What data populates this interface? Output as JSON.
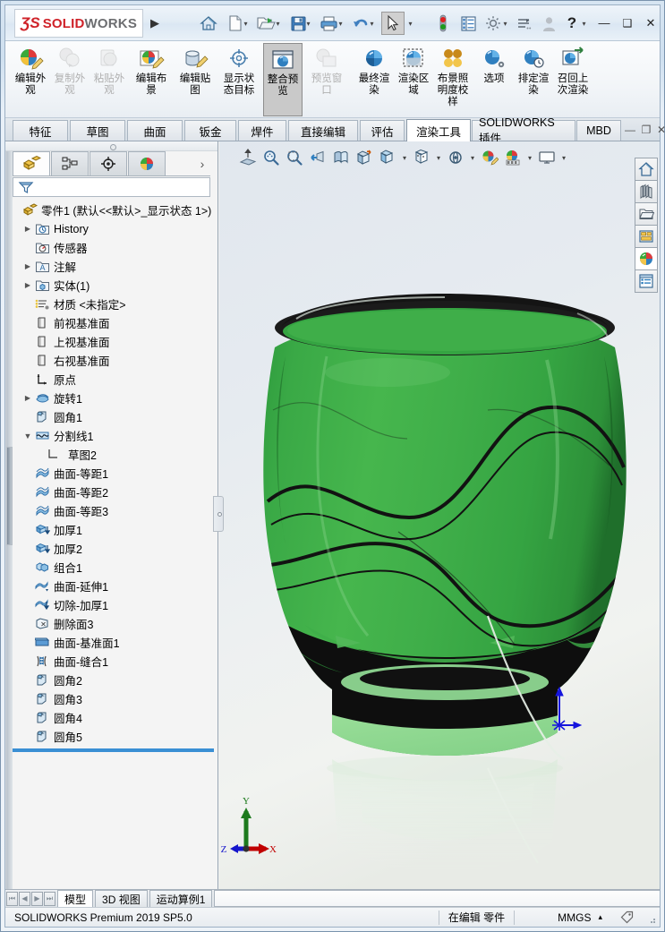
{
  "app": {
    "logo_ds": "ƷS",
    "logo_bold": "SOLID",
    "logo_light": "WORKS",
    "logo_arrow": "▶"
  },
  "titlebar": {
    "icons": [
      {
        "name": "home-icon",
        "label": "home"
      },
      {
        "name": "new-document-icon",
        "label": "new"
      },
      {
        "name": "open-document-icon",
        "label": "open"
      },
      {
        "name": "save-icon",
        "label": "save"
      },
      {
        "name": "print-icon",
        "label": "print"
      },
      {
        "name": "undo-icon",
        "label": "undo"
      },
      {
        "name": "select-cursor-icon",
        "label": "select"
      },
      {
        "name": "rebuild-icon",
        "label": "rebuild"
      },
      {
        "name": "options-list-icon",
        "label": "options-list"
      },
      {
        "name": "settings-gear-icon",
        "label": "settings"
      },
      {
        "name": "customize-icon",
        "label": "customize"
      },
      {
        "name": "user-account-icon",
        "label": "account"
      },
      {
        "name": "help-icon",
        "label": "help"
      }
    ],
    "window_buttons": {
      "minimize": "—",
      "maximize": "❑",
      "close": "✕"
    }
  },
  "ribbon": {
    "buttons": [
      {
        "label": "编辑外观",
        "name": "edit-appearance-button",
        "enabled": true,
        "selected": false,
        "icon": "appearance-edit-icon"
      },
      {
        "label": "复制外观",
        "name": "copy-appearance-button",
        "enabled": false,
        "selected": false,
        "icon": "appearance-copy-icon"
      },
      {
        "label": "粘贴外观",
        "name": "paste-appearance-button",
        "enabled": false,
        "selected": false,
        "icon": "appearance-paste-icon"
      },
      {
        "label": "编辑布景",
        "name": "edit-scene-button",
        "enabled": true,
        "selected": false,
        "icon": "scene-edit-icon"
      },
      {
        "label": "编辑贴图",
        "name": "edit-decal-button",
        "enabled": true,
        "selected": false,
        "icon": "decal-edit-icon"
      },
      {
        "label": "显示状态目标",
        "name": "display-state-target-button",
        "enabled": true,
        "selected": false,
        "icon": "display-state-icon"
      },
      {
        "label": "整合预览",
        "name": "integrated-preview-button",
        "enabled": true,
        "selected": true,
        "icon": "integrated-preview-icon"
      },
      {
        "label": "预览窗口",
        "name": "preview-window-button",
        "enabled": false,
        "selected": false,
        "icon": "preview-window-icon"
      },
      {
        "label": "最终渲染",
        "name": "final-render-button",
        "enabled": true,
        "selected": false,
        "icon": "final-render-icon"
      },
      {
        "label": "渲染区域",
        "name": "render-region-button",
        "enabled": true,
        "selected": false,
        "icon": "render-region-icon"
      },
      {
        "label": "布景照明度校样",
        "name": "scene-illumination-proof-button",
        "enabled": true,
        "selected": false,
        "icon": "illumination-proof-icon"
      },
      {
        "label": "选项",
        "name": "options-button",
        "enabled": true,
        "selected": false,
        "icon": "render-options-icon"
      },
      {
        "label": "排定渲染",
        "name": "schedule-render-button",
        "enabled": true,
        "selected": false,
        "icon": "schedule-render-icon"
      },
      {
        "label": "召回上次渲染",
        "name": "recall-last-render-button",
        "enabled": true,
        "selected": false,
        "icon": "recall-render-icon"
      }
    ]
  },
  "tabs": {
    "items": [
      {
        "label": "特征",
        "name": "tab-features",
        "active": false
      },
      {
        "label": "草图",
        "name": "tab-sketch",
        "active": false
      },
      {
        "label": "曲面",
        "name": "tab-surfaces",
        "active": false
      },
      {
        "label": "钣金",
        "name": "tab-sheetmetal",
        "active": false
      },
      {
        "label": "焊件",
        "name": "tab-weldments",
        "active": false
      },
      {
        "label": "直接编辑",
        "name": "tab-direct-editing",
        "active": false
      },
      {
        "label": "评估",
        "name": "tab-evaluate",
        "active": false
      },
      {
        "label": "渲染工具",
        "name": "tab-render-tools",
        "active": true
      },
      {
        "label": "SOLIDWORKS 插件",
        "name": "tab-solidworks-addins",
        "active": false
      },
      {
        "label": "MBD",
        "name": "tab-mbd",
        "active": false
      }
    ],
    "window_buttons": {
      "minimize": "—",
      "restore": "❐",
      "close": "✕"
    }
  },
  "feature_manager": {
    "tabs": [
      {
        "name": "feature-manager-tree-tab",
        "icon": "feature-tree-icon",
        "active": true
      },
      {
        "name": "property-manager-tab",
        "icon": "property-manager-icon",
        "active": false
      },
      {
        "name": "configuration-manager-tab",
        "icon": "configuration-manager-icon",
        "active": false
      },
      {
        "name": "display-manager-tab",
        "icon": "display-manager-icon",
        "active": false
      }
    ],
    "more_arrow": "›",
    "filter": {
      "name": "tree-filter-input",
      "placeholder": "",
      "value": "",
      "icon": "filter-funnel-icon"
    },
    "tree": [
      {
        "label": "零件1  (默认<<默认>_显示状态 1>)",
        "indent": 0,
        "expander": "",
        "icon": "part-icon",
        "bold": false
      },
      {
        "label": "History",
        "indent": 1,
        "expander": "▶",
        "icon": "history-folder-icon",
        "bold": false
      },
      {
        "label": "传感器",
        "indent": 1,
        "expander": "",
        "icon": "sensor-folder-icon",
        "bold": false
      },
      {
        "label": "注解",
        "indent": 1,
        "expander": "▶",
        "icon": "annotations-folder-icon",
        "bold": false
      },
      {
        "label": "实体(1)",
        "indent": 1,
        "expander": "▶",
        "icon": "solid-bodies-folder-icon",
        "bold": false
      },
      {
        "label": "材质 <未指定>",
        "indent": 1,
        "expander": "",
        "icon": "material-icon",
        "bold": false
      },
      {
        "label": "前视基准面",
        "indent": 1,
        "expander": "",
        "icon": "plane-icon",
        "bold": false
      },
      {
        "label": "上视基准面",
        "indent": 1,
        "expander": "",
        "icon": "plane-icon",
        "bold": false
      },
      {
        "label": "右视基准面",
        "indent": 1,
        "expander": "",
        "icon": "plane-icon",
        "bold": false
      },
      {
        "label": "原点",
        "indent": 1,
        "expander": "",
        "icon": "origin-icon",
        "bold": false
      },
      {
        "label": "旋转1",
        "indent": 1,
        "expander": "▶",
        "icon": "revolve-icon",
        "bold": false
      },
      {
        "label": "圆角1",
        "indent": 1,
        "expander": "",
        "icon": "fillet-icon",
        "bold": false
      },
      {
        "label": "分割线1",
        "indent": 1,
        "expander": "▼",
        "icon": "split-line-icon",
        "bold": false
      },
      {
        "label": "草图2",
        "indent": 2,
        "expander": "",
        "icon": "sketch-icon",
        "bold": false
      },
      {
        "label": "曲面-等距1",
        "indent": 1,
        "expander": "",
        "icon": "offset-surface-icon",
        "bold": false
      },
      {
        "label": "曲面-等距2",
        "indent": 1,
        "expander": "",
        "icon": "offset-surface-icon",
        "bold": false
      },
      {
        "label": "曲面-等距3",
        "indent": 1,
        "expander": "",
        "icon": "offset-surface-icon",
        "bold": false
      },
      {
        "label": "加厚1",
        "indent": 1,
        "expander": "",
        "icon": "thicken-icon",
        "bold": false
      },
      {
        "label": "加厚2",
        "indent": 1,
        "expander": "",
        "icon": "thicken-icon",
        "bold": false
      },
      {
        "label": "组合1",
        "indent": 1,
        "expander": "",
        "icon": "combine-icon",
        "bold": false
      },
      {
        "label": "曲面-延伸1",
        "indent": 1,
        "expander": "",
        "icon": "extend-surface-icon",
        "bold": false
      },
      {
        "label": "切除-加厚1",
        "indent": 1,
        "expander": "",
        "icon": "thicken-cut-icon",
        "bold": false
      },
      {
        "label": "删除面3",
        "indent": 1,
        "expander": "",
        "icon": "delete-face-icon",
        "bold": false
      },
      {
        "label": "曲面-基准面1",
        "indent": 1,
        "expander": "",
        "icon": "planar-surface-icon",
        "bold": false
      },
      {
        "label": "曲面-缝合1",
        "indent": 1,
        "expander": "",
        "icon": "knit-surface-icon",
        "bold": false
      },
      {
        "label": "圆角2",
        "indent": 1,
        "expander": "",
        "icon": "fillet-icon",
        "bold": false
      },
      {
        "label": "圆角3",
        "indent": 1,
        "expander": "",
        "icon": "fillet-icon",
        "bold": false
      },
      {
        "label": "圆角4",
        "indent": 1,
        "expander": "",
        "icon": "fillet-icon",
        "bold": false
      },
      {
        "label": "圆角5",
        "indent": 1,
        "expander": "",
        "icon": "fillet-icon",
        "bold": false
      }
    ],
    "rollback_bar": {
      "name": "rollback-bar",
      "color": "#3a8fd4"
    }
  },
  "view_toolbar": {
    "buttons": [
      {
        "name": "zoom-to-fit-icon",
        "label": "整屏显示全图"
      },
      {
        "name": "zoom-to-area-icon",
        "label": "局部放大"
      },
      {
        "name": "zoom-in-out-icon",
        "label": "放大或缩小"
      },
      {
        "name": "previous-view-icon",
        "label": "上一视图"
      },
      {
        "name": "section-view-icon",
        "label": "剖面视图"
      },
      {
        "name": "view-orientation-icon",
        "label": "视图定向"
      },
      {
        "name": "display-style-icon",
        "label": "显示样式"
      },
      {
        "name": "hide-show-items-icon",
        "label": "隐藏/显示项目"
      },
      {
        "name": "edit-appearance-view-icon",
        "label": "编辑外观"
      },
      {
        "name": "apply-scene-icon",
        "label": "应用布景"
      },
      {
        "name": "view-settings-icon",
        "label": "视图设定"
      }
    ]
  },
  "right_dock": {
    "items": [
      {
        "name": "design-library-home-icon",
        "active": false
      },
      {
        "name": "design-library-icon",
        "active": false
      },
      {
        "name": "file-explorer-icon",
        "active": false
      },
      {
        "name": "view-palette-icon",
        "active": false
      },
      {
        "name": "appearances-scenes-decals-icon",
        "active": true
      },
      {
        "name": "custom-properties-icon",
        "active": false
      }
    ]
  },
  "graphics": {
    "triad": {
      "x_label": "X",
      "y_label": "Y",
      "z_label": "Z",
      "x_color": "#cc0000",
      "y_color": "#008000",
      "z_color": "#0000cc"
    },
    "origin": {
      "name": "origin-marker",
      "color": "#0000cc"
    },
    "model": {
      "name": "glass-vase-model",
      "body_color": "#3fae49",
      "band_color": "#101010",
      "base_color": "#96dc96",
      "background_top": "#e3e8ee",
      "background_bottom": "#eceeea"
    }
  },
  "bottom": {
    "nav_buttons": [
      "⏮",
      "◀",
      "▶",
      "⏭"
    ],
    "sheet_tabs": [
      {
        "label": "模型",
        "name": "sheet-tab-model",
        "active": true
      },
      {
        "label": "3D 视图",
        "name": "sheet-tab-3d-views",
        "active": false
      },
      {
        "label": "运动算例1",
        "name": "sheet-tab-motion-study",
        "active": false
      }
    ],
    "status": {
      "product": "SOLIDWORKS Premium 2019 SP5.0",
      "editing": "在编辑 零件",
      "units": "MMGS",
      "units_caret": "▴",
      "tag_icon": "tags-icon"
    }
  }
}
